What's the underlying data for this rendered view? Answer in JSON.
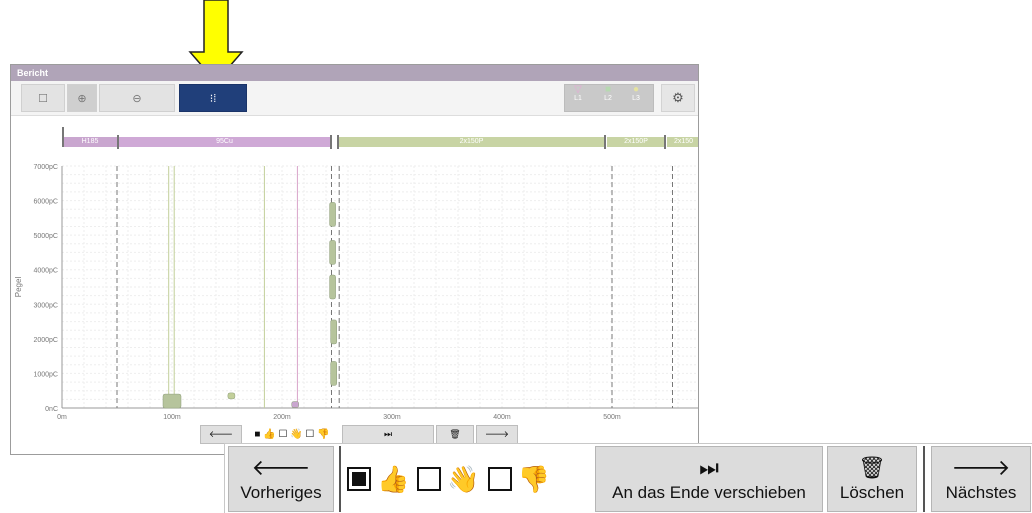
{
  "window": {
    "title": "Bericht"
  },
  "toolbar": {
    "select_icon": "rectangle-select-icon",
    "zoom_in_icon": "zoom-in-icon",
    "zoom_out_icon": "zoom-out-icon",
    "scatter_icon": "scatter-view-icon",
    "settings_icon": "gear-icon",
    "levels": [
      {
        "label": "L1",
        "symbol": "triangle",
        "color": "#d9a3c8"
      },
      {
        "label": "L2",
        "symbol": "square",
        "color": "#b6d9b0"
      },
      {
        "label": "L3",
        "symbol": "circle",
        "color": "#e6e3a0"
      }
    ]
  },
  "segments": [
    {
      "label": "H185",
      "color": "#c9a6cf"
    },
    {
      "label": "95Cu",
      "color": "#c9a6cf"
    },
    {
      "label": "2x150P",
      "color": "#c2cf9a"
    },
    {
      "label": "2x150P",
      "color": "#c2cf9a"
    },
    {
      "label": "2x150",
      "color": "#c2cf9a"
    }
  ],
  "chart_data": {
    "type": "scatter",
    "ylabel": "Pegel",
    "xlabel": "",
    "x_ticks": [
      "0m",
      "100m",
      "200m",
      "300m",
      "400m",
      "500m"
    ],
    "y_ticks": [
      "0nC",
      "1000pC",
      "2000pC",
      "3000pC",
      "4000pC",
      "5000pC",
      "6000pC",
      "7000pC"
    ],
    "xlim": [
      0,
      580
    ],
    "ylim": [
      0,
      7000
    ],
    "boundaries_m": [
      50,
      245,
      252,
      500,
      555
    ],
    "vertical_lines_m": [
      {
        "x": 97,
        "color": "#c2cf9a"
      },
      {
        "x": 102,
        "color": "#c2cf9a"
      },
      {
        "x": 184,
        "color": "#c2cf9a"
      },
      {
        "x": 214,
        "color": "#d9a3c8"
      }
    ],
    "clusters": [
      {
        "x": 100,
        "y": 200,
        "color": "#b6c49c"
      },
      {
        "x": 154,
        "y": 350,
        "color": "#c2cf9a"
      },
      {
        "x": 212,
        "y": 100,
        "color": "#c9a6cf"
      },
      {
        "x": 246,
        "y": 5600,
        "color": "#b6c49c"
      },
      {
        "x": 246,
        "y": 4500,
        "color": "#b6c49c"
      },
      {
        "x": 246,
        "y": 3500,
        "color": "#b6c49c"
      },
      {
        "x": 247,
        "y": 2200,
        "color": "#b6c49c"
      },
      {
        "x": 247,
        "y": 1000,
        "color": "#b6c49c"
      }
    ]
  },
  "mini_bar": {
    "prev_icon": "arrow-left-icon",
    "delete_icon": "trash-icon",
    "next_icon": "arrow-right-icon"
  },
  "actions": {
    "previous": {
      "label": "Vorheriges",
      "icon": "arrow-left-icon"
    },
    "rating": {
      "good_icon": "thumbs-up-icon",
      "wave_icon": "waving-hand-icon",
      "bad_icon": "thumbs-down-icon"
    },
    "move_end": {
      "label": "An das Ende verschieben",
      "icon": "skip-to-end-icon"
    },
    "delete": {
      "label": "Löschen",
      "icon": "trash-icon"
    },
    "next": {
      "label": "Nächstes",
      "icon": "arrow-right-icon"
    }
  }
}
